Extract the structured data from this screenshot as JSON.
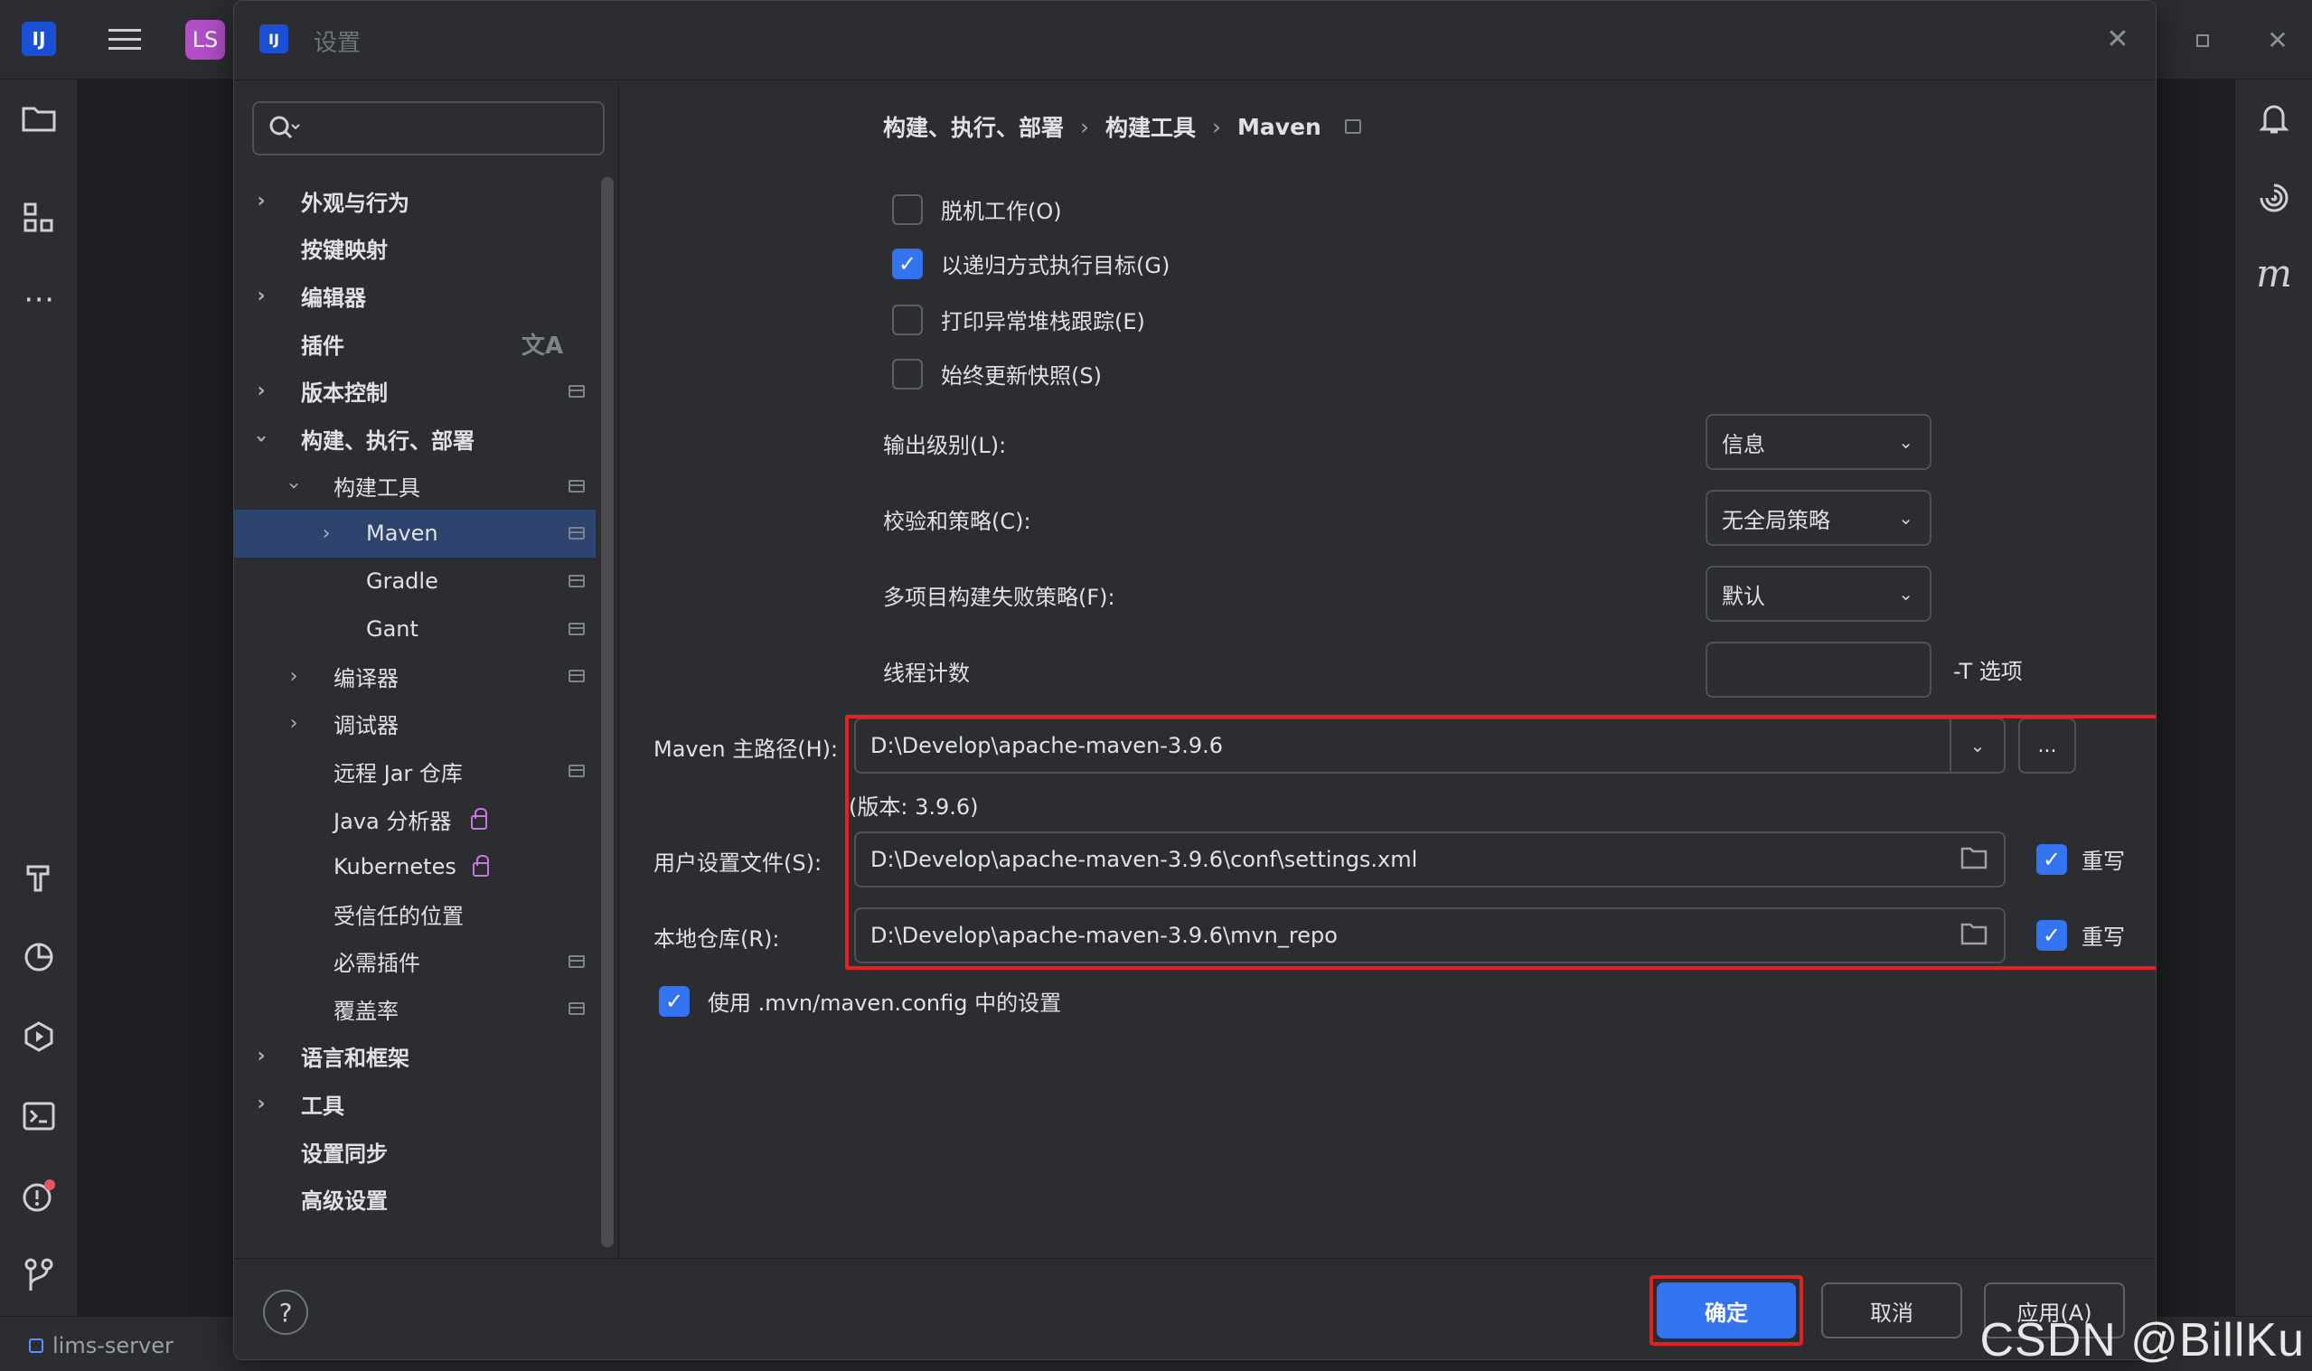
{
  "ide": {
    "project_badge": "LS",
    "status_project": "lims-server"
  },
  "dialog": {
    "title": "设置",
    "search_placeholder": ""
  },
  "nav": {
    "items": [
      {
        "label": "外观与行为",
        "expandable": true
      },
      {
        "label": "按键映射",
        "expandable": false
      },
      {
        "label": "编辑器",
        "expandable": true
      },
      {
        "label": "插件",
        "expandable": false
      },
      {
        "label": "版本控制",
        "expandable": true
      },
      {
        "label": "构建、执行、部署",
        "expandable": true,
        "expanded": true
      },
      {
        "label": "构建工具",
        "expandable": true,
        "expanded": true
      },
      {
        "label": "Maven",
        "expandable": true,
        "selected": true
      },
      {
        "label": "Gradle",
        "expandable": false
      },
      {
        "label": "Gant",
        "expandable": false
      },
      {
        "label": "编译器",
        "expandable": true
      },
      {
        "label": "调试器",
        "expandable": true
      },
      {
        "label": "远程 Jar 仓库",
        "expandable": false
      },
      {
        "label": "Java 分析器",
        "expandable": false
      },
      {
        "label": "Kubernetes",
        "expandable": false
      },
      {
        "label": "受信任的位置",
        "expandable": false
      },
      {
        "label": "必需插件",
        "expandable": false
      },
      {
        "label": "覆盖率",
        "expandable": false
      },
      {
        "label": "语言和框架",
        "expandable": true
      },
      {
        "label": "工具",
        "expandable": true
      },
      {
        "label": "设置同步",
        "expandable": false
      },
      {
        "label": "高级设置",
        "expandable": false
      }
    ]
  },
  "breadcrumb": {
    "parts": [
      "构建、执行、部署",
      "构建工具",
      "Maven"
    ],
    "reset": "重置"
  },
  "options": {
    "offline": {
      "label": "脱机工作(O)",
      "checked": false
    },
    "recursive": {
      "label": "以递归方式执行目标(G)",
      "checked": true
    },
    "stacktrace": {
      "label": "打印异常堆栈跟踪(E)",
      "checked": false
    },
    "snapshots": {
      "label": "始终更新快照(S)",
      "checked": false
    },
    "use_mvn_config": {
      "label": "使用 .mvn/maven.config 中的设置",
      "checked": true
    }
  },
  "fields": {
    "output_level": {
      "label": "输出级别(L):",
      "value": "信息"
    },
    "checksum": {
      "label": "校验和策略(C):",
      "value": "无全局策略"
    },
    "fail_policy": {
      "label": "多项目构建失败策略(F):",
      "value": "默认"
    },
    "threads": {
      "label": "线程计数",
      "value": "",
      "hint": "-T 选项"
    },
    "maven_home": {
      "label": "Maven 主路径(H):",
      "value": "D:\\Develop\\apache-maven-3.9.6",
      "browse": "..."
    },
    "version": "(版本: 3.9.6)",
    "user_settings": {
      "label": "用户设置文件(S):",
      "value": "D:\\Develop\\apache-maven-3.9.6\\conf\\settings.xml",
      "override": "重写",
      "override_checked": true
    },
    "local_repo": {
      "label": "本地仓库(R):",
      "value": "D:\\Develop\\apache-maven-3.9.6\\mvn_repo",
      "override": "重写",
      "override_checked": true
    }
  },
  "footer": {
    "help": "?",
    "ok": "确定",
    "cancel": "取消",
    "apply": "应用(A)"
  },
  "watermark": "CSDN @BillKu",
  "colors": {
    "accent": "#3574f0",
    "highlight_border": "#e0231e",
    "selected_row": "#2e436e",
    "link": "#548af7"
  }
}
